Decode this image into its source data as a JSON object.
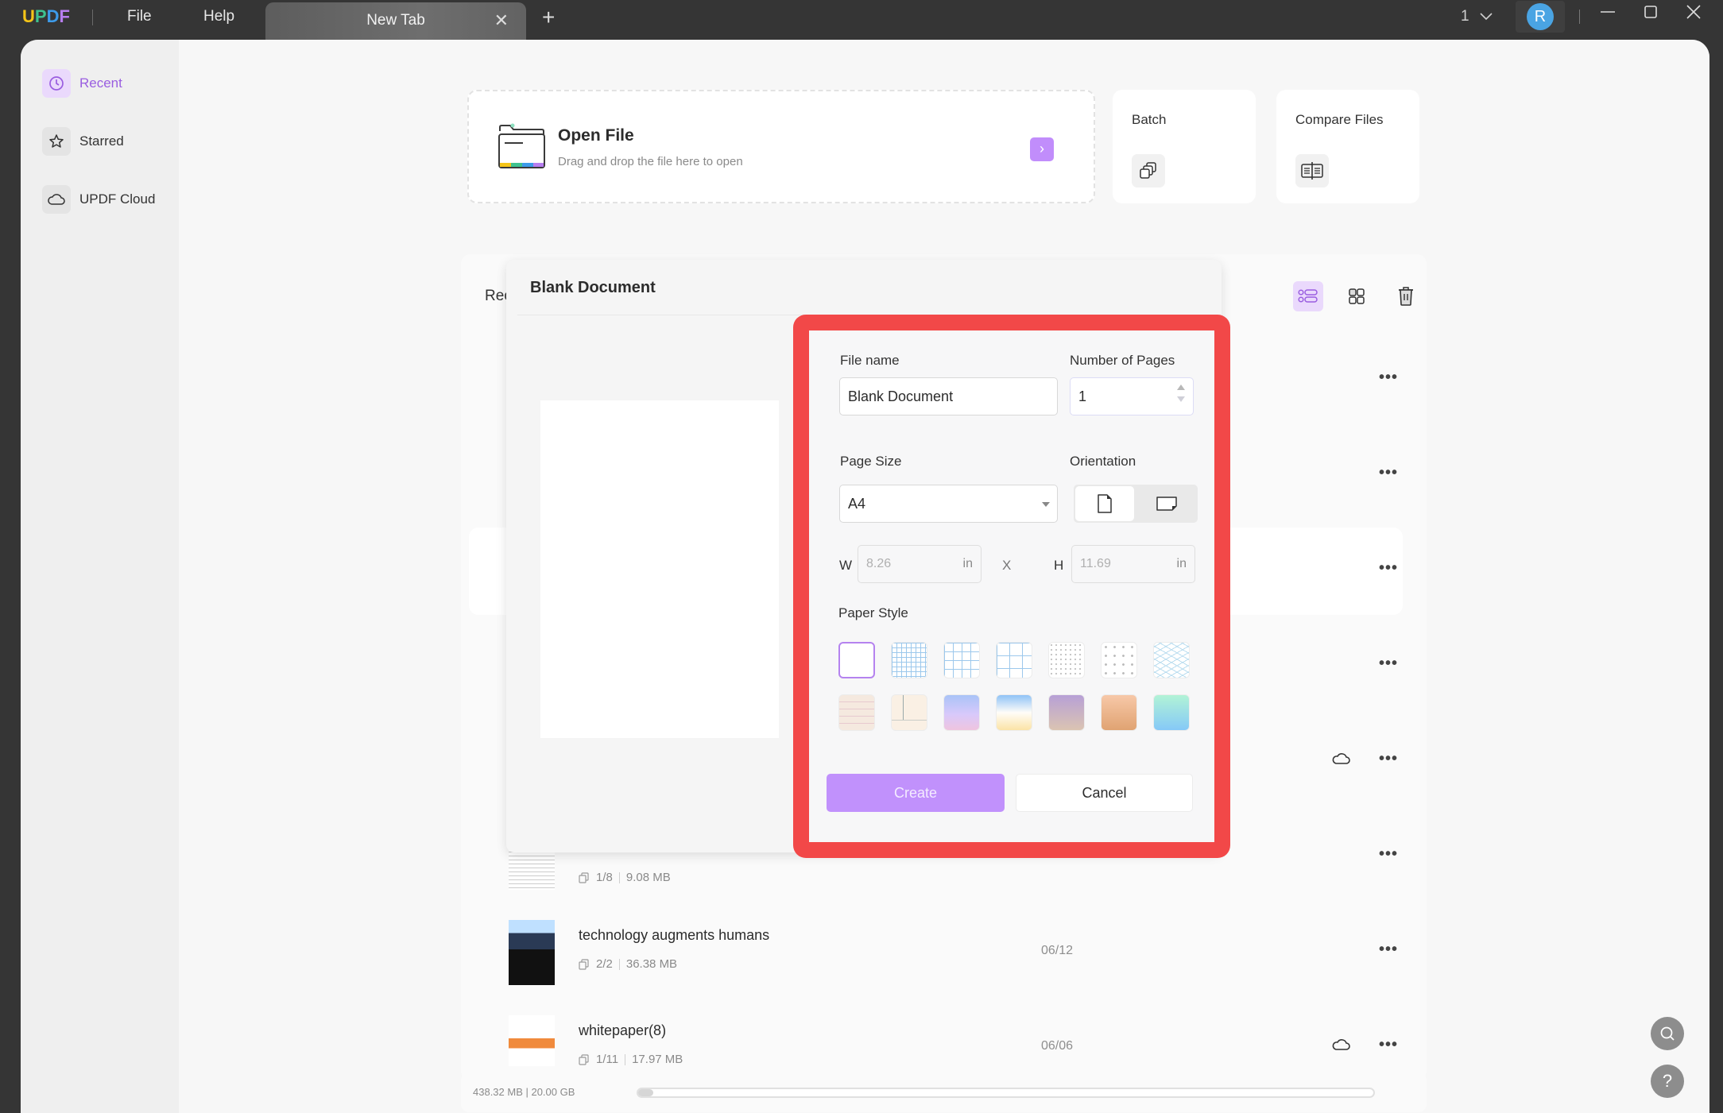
{
  "titlebar": {
    "logo": [
      "U",
      "P",
      "D",
      "F"
    ],
    "logo_colors": [
      "#f5c518",
      "#3ec28f",
      "#3d9be9",
      "#b77ef0"
    ],
    "menu": [
      "File",
      "Help"
    ],
    "tab_label": "New Tab",
    "page_indicator": "1",
    "avatar_initial": "R"
  },
  "sidebar": {
    "items": [
      {
        "label": "Recent",
        "icon": "clock-icon",
        "active": true
      },
      {
        "label": "Starred",
        "icon": "star-icon",
        "active": false
      },
      {
        "label": "UPDF Cloud",
        "icon": "cloud-icon",
        "active": false
      }
    ]
  },
  "open_file": {
    "title": "Open File",
    "subtitle": "Drag and drop the file here to open",
    "go_glyph": "›"
  },
  "tools": {
    "batch": "Batch",
    "compare": "Compare Files"
  },
  "recent": {
    "title": "Recent",
    "files": [
      {
        "name": "",
        "pages": "",
        "size": "",
        "date": "",
        "cloud": false
      },
      {
        "name": "",
        "pages": "",
        "size": "",
        "date": "",
        "cloud": false
      },
      {
        "name": "",
        "pages": "",
        "size": "",
        "date": "",
        "cloud": false
      },
      {
        "name": "",
        "pages": "",
        "size": "",
        "date": "",
        "cloud": false
      },
      {
        "name": "",
        "pages": "",
        "size": "",
        "date": "",
        "cloud": true
      },
      {
        "name": "",
        "pages": "1/8",
        "size": "9.08 MB",
        "date": "",
        "cloud": false
      },
      {
        "name": "technology augments humans",
        "pages": "2/2",
        "size": "36.38 MB",
        "date": "06/12",
        "cloud": false
      },
      {
        "name": "whitepaper(8)",
        "pages": "1/11",
        "size": "17.97 MB",
        "date": "06/06",
        "cloud": true
      }
    ],
    "more_glyph": "•••"
  },
  "storage": {
    "text": "438.32 MB | 20.00 GB",
    "used_fraction": 0.021
  },
  "dialog": {
    "title": "Blank Document",
    "file_name_label": "File name",
    "file_name_value": "Blank Document",
    "pages_label": "Number of Pages",
    "pages_value": "1",
    "page_size_label": "Page Size",
    "page_size_value": "A4",
    "orientation_label": "Orientation",
    "orientation_selected": "portrait",
    "w_label": "W",
    "w_value": "8.26",
    "h_label": "H",
    "h_value": "11.69",
    "unit": "in",
    "times": "X",
    "paper_style_label": "Paper Style",
    "paper_styles": [
      "blank",
      "small-grid",
      "medium-grid",
      "large-grid",
      "small-dots",
      "large-dots",
      "isometric",
      "lined-ruled",
      "cornell",
      "gradient-blue-pink",
      "gradient-sky-sand",
      "gradient-purple-tan",
      "gradient-peach",
      "gradient-mint-blue"
    ],
    "paper_style_selected": "blank",
    "create_label": "Create",
    "cancel_label": "Cancel"
  },
  "fabs": {
    "search": "search-icon",
    "help": "?"
  },
  "colors": {
    "accent": "#c191fc",
    "highlight": "#f24848",
    "active_text": "#9a5ee0"
  }
}
